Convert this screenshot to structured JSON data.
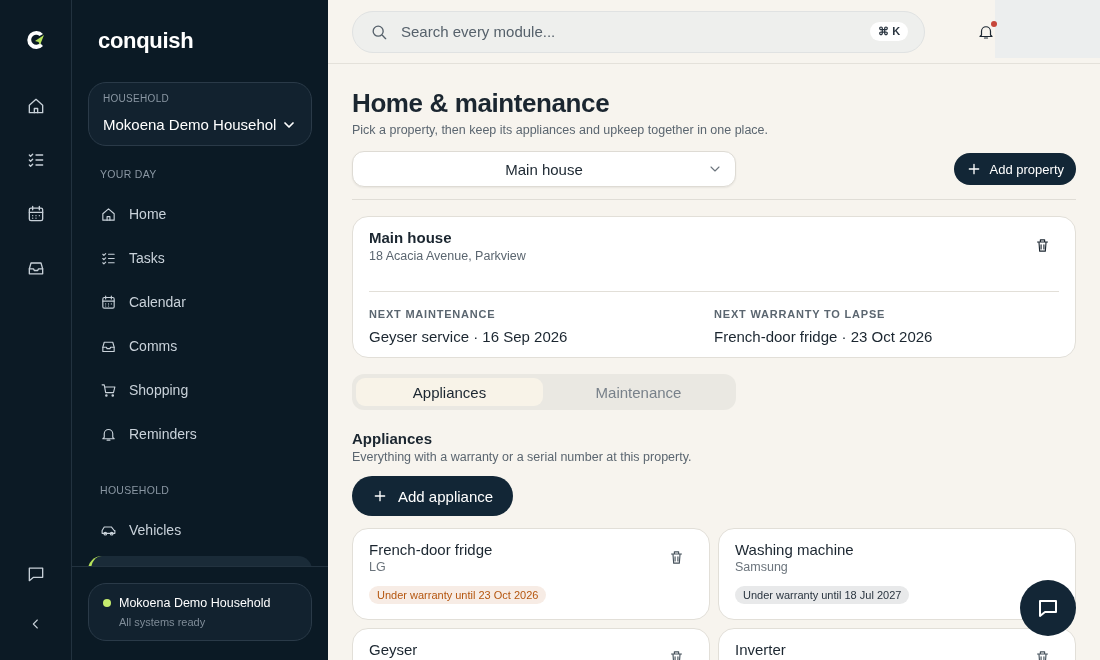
{
  "brand": {
    "name": "conquish"
  },
  "household_picker": {
    "label": "HOUSEHOLD",
    "value": "Mokoena Demo Househol"
  },
  "nav_sections": [
    {
      "title": "YOUR DAY",
      "items": [
        {
          "label": "Home",
          "selected": false
        },
        {
          "label": "Tasks",
          "selected": false
        },
        {
          "label": "Calendar",
          "selected": false
        },
        {
          "label": "Comms",
          "selected": false
        },
        {
          "label": "Shopping",
          "selected": false
        },
        {
          "label": "Reminders",
          "selected": false
        }
      ]
    },
    {
      "title": "HOUSEHOLD",
      "items": [
        {
          "label": "Vehicles",
          "selected": false
        },
        {
          "selected": true
        }
      ]
    }
  ],
  "status_card": {
    "name": "Mokoena Demo Household",
    "status": "All systems ready",
    "color": "#c5ec6e"
  },
  "search": {
    "placeholder": "Search every module...",
    "shortcut": "⌘ K"
  },
  "notifications": {
    "unread": true
  },
  "page": {
    "title": "Home & maintenance",
    "subtitle": "Pick a property, then keep its appliances and upkeep together in one place."
  },
  "property_select": {
    "value": "Main house"
  },
  "add_property": "Add property",
  "property": {
    "name": "Main house",
    "address": "18 Acacia Avenue, Parkview",
    "facts": [
      {
        "label": "NEXT MAINTENANCE",
        "value": "Geyser service · 16 Sep 2026"
      },
      {
        "label": "NEXT WARRANTY TO LAPSE",
        "value": "French-door fridge · 23 Oct 2026"
      }
    ]
  },
  "tabs": [
    {
      "label": "Appliances",
      "selected": true
    },
    {
      "label": "Maintenance",
      "selected": false
    }
  ],
  "section": {
    "title": "Appliances",
    "subtitle": "Everything with a warranty or a serial number at this property."
  },
  "add_appliance": "Add appliance",
  "appliances": [
    {
      "name": "French-door fridge",
      "brand": "LG",
      "deletable": true,
      "badge": {
        "text": "Under warranty until 23 Oct 2026",
        "color": "#b5560f"
      }
    },
    {
      "name": "Washing machine",
      "brand": "Samsung",
      "deletable": false,
      "badge": {
        "text": "Under warranty until 18 Jul 2027",
        "color": "#2a3540"
      }
    },
    {
      "name": "Geyser",
      "deletable": true
    },
    {
      "name": "Inverter",
      "deletable": true
    }
  ]
}
